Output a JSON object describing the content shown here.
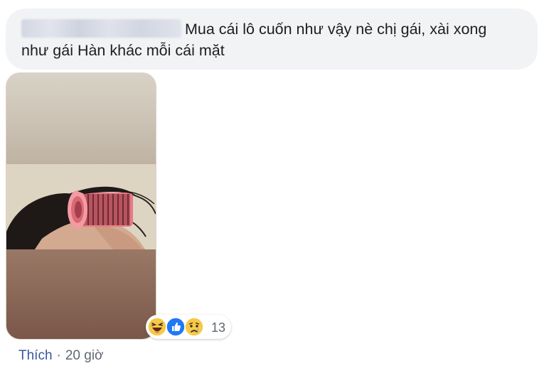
{
  "comment": {
    "text_line1": "Mua cái lô cuốn như vậy nè chị gái, xài xong",
    "text_line2": "như gái Hàn khác mỗi cái mặt"
  },
  "photo": {
    "subject": "hair roller on head"
  },
  "reactions": {
    "icons": [
      "haha-icon",
      "like-icon",
      "sad-icon"
    ],
    "count": "13"
  },
  "footer": {
    "like_label": "Thích",
    "separator": "·",
    "time": "20 giờ"
  },
  "colors": {
    "bubble": "#f2f3f5",
    "text": "#1c1e21",
    "link": "#385898",
    "meta": "#606770",
    "like_blue": "#2078f4",
    "emoji_yellow": "#f7c948"
  }
}
